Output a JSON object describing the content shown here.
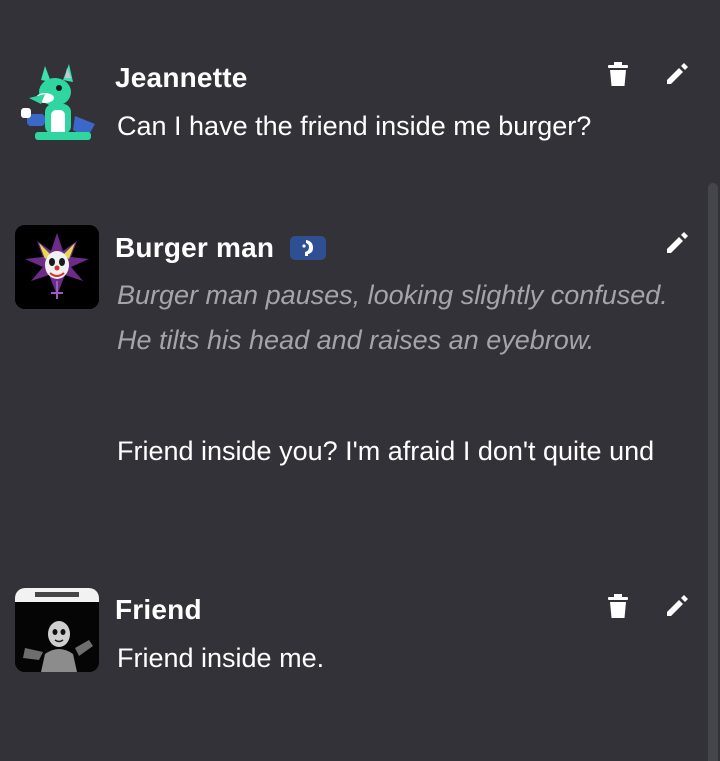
{
  "messages": [
    {
      "author": "Jeannette",
      "avatar_icon": "fox-character-avatar",
      "text": "Can I have the friend inside me burger?",
      "can_delete": true,
      "can_edit": true
    },
    {
      "author": "Burger man",
      "avatar_icon": "clown-face-avatar",
      "badge_icon": "bot-badge-icon",
      "action_text": "Burger man pauses, looking slightly confused. He tilts his head and raises an eyebrow.",
      "text": "Friend inside you? I'm afraid I don't quite und",
      "can_delete": false,
      "can_edit": true
    },
    {
      "author": "Friend",
      "avatar_icon": "dark-figure-avatar",
      "text": "Friend inside me.",
      "can_delete": true,
      "can_edit": true
    }
  ],
  "colors": {
    "background": "#323238",
    "text": "#ffffff",
    "action_text": "#a4a4aa",
    "badge": "#2f4f93"
  }
}
